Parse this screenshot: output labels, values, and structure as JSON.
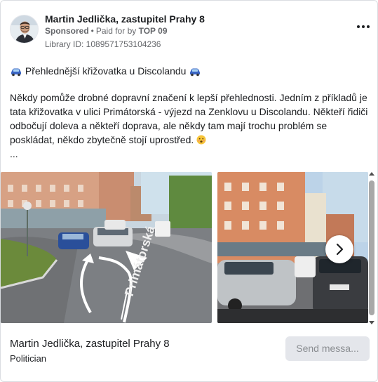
{
  "post": {
    "author": "Martin Jedlička, zastupitel Prahy 8",
    "sponsored": "Sponsored",
    "separator": "•",
    "paid_for_by": "Paid for by",
    "payer": "TOP 09",
    "library_id": "Library ID: 1089571753104236",
    "title": "Přehlednější křižovatka u Discolandu",
    "body": "Někdy pomůže drobné dopravní značení k lepší přehlednosti. Jedním z příkladů je tata křižovatka v ulici Primátorská - výjezd na Zenklovu u Discolandu. Někteří řidiči odbočují doleva a někteří doprava, ale někdy tam mají trochu problém se poskládat, někdo zbytečně stojí uprostřed.",
    "ellipsis": "...",
    "icons": [
      "avatar-photo",
      "more-options-icon",
      "car-emoji-icon",
      "face-emoji-icon",
      "chevron-right-icon"
    ]
  },
  "carousel": {
    "slides": [
      {
        "kind": "photo",
        "description_name": "intersection-photo-with-arrows",
        "street_text": "Primátorská"
      },
      {
        "kind": "photo",
        "description_name": "traffic-queue-photo"
      }
    ],
    "accent": "#ffffff"
  },
  "footer": {
    "page_name": "Martin Jedlička, zastupitel Prahy 8",
    "category": "Politician",
    "send_label": "Send messa..."
  },
  "colors": {
    "text_primary": "#1c1e21",
    "text_secondary": "#65676b",
    "button_bg": "#e4e6eb",
    "button_text": "#8a8d91"
  }
}
